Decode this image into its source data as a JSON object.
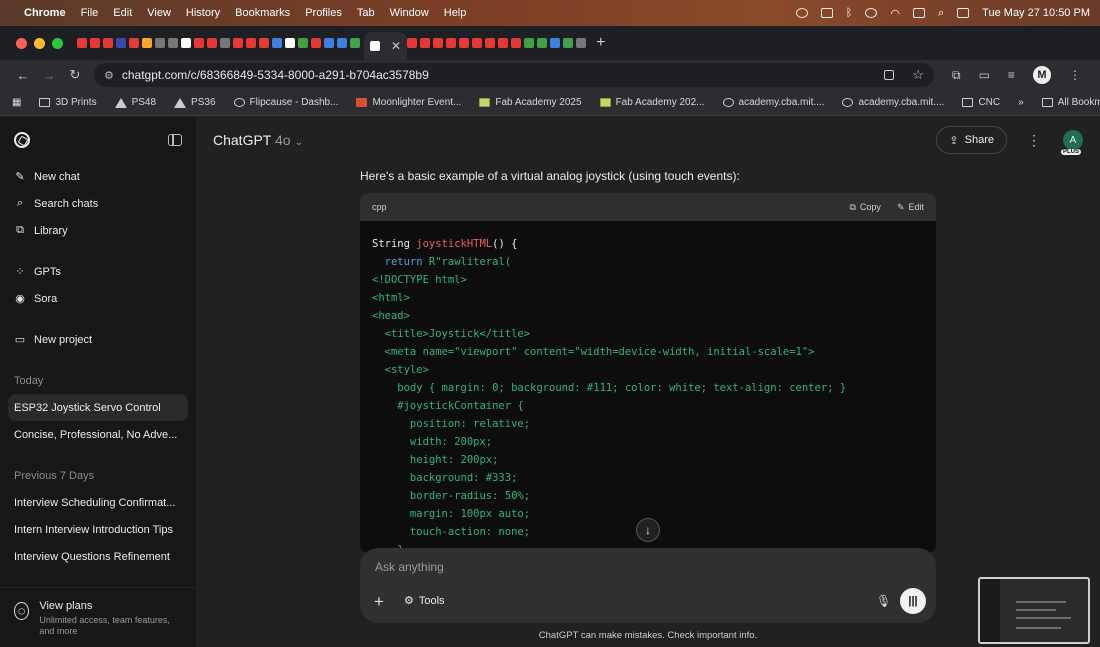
{
  "menubar": {
    "app": "Chrome",
    "items": [
      "File",
      "Edit",
      "View",
      "History",
      "Bookmarks",
      "Profiles",
      "Tab",
      "Window",
      "Help"
    ],
    "clock": "Tue May 27  10:50 PM"
  },
  "browser": {
    "url": "chatgpt.com/c/68366849-5334-8000-a291-b704ac3578b9",
    "bookmarks": [
      "3D Prints",
      "PS48",
      "PS36",
      "Flipcause - Dashb...",
      "Moonlighter Event...",
      "Fab Academy 2025",
      "Fab Academy 202...",
      "academy.cba.mit....",
      "academy.cba.mit....",
      "CNC"
    ],
    "all_bookmarks": "All Bookmarks",
    "profile_initial": "M"
  },
  "sidebar": {
    "actions": [
      {
        "label": "New chat",
        "icon": "pencil-square-icon"
      },
      {
        "label": "Search chats",
        "icon": "search-icon"
      },
      {
        "label": "Library",
        "icon": "library-icon"
      }
    ],
    "tools": [
      {
        "label": "GPTs",
        "icon": "grid-icon"
      },
      {
        "label": "Sora",
        "icon": "play-circle-icon"
      }
    ],
    "new_project": "New project",
    "today_label": "Today",
    "today_chats": [
      "ESP32 Joystick Servo Control",
      "Concise, Professional, No Adve..."
    ],
    "prev_label": "Previous 7 Days",
    "prev_chats": [
      "Interview Scheduling Confirmat...",
      "Intern Interview Introduction Tips",
      "Interview Questions Refinement"
    ],
    "view_plans_title": "View plans",
    "view_plans_sub": "Unlimited access, team features, and more"
  },
  "header": {
    "model_name": "ChatGPT",
    "model_version": "4o",
    "share_label": "Share",
    "avatar_initial": "A",
    "plan_badge": "PLUS"
  },
  "message": {
    "intro": "Here's a basic example of a virtual analog joystick (using touch events):",
    "code_lang": "cpp",
    "copy_label": "Copy",
    "edit_label": "Edit",
    "code": {
      "l1a": "String ",
      "l1fn": "joystickHTML",
      "l1b": "() {",
      "l2kw": "  return ",
      "l2b": "R\"rawliteral(",
      "lines": [
        "<!DOCTYPE html>",
        "<html>",
        "<head>",
        "  <title>Joystick</title>",
        "  <meta name=\"viewport\" content=\"width=device-width, initial-scale=1\">",
        "  <style>",
        "    body { margin: 0; background: #111; color: white; text-align: center; }",
        "    #joystickContainer {",
        "      position: relative;",
        "      width: 200px;",
        "      height: 200px;",
        "      background: #333;",
        "      border-radius: 50%;",
        "      margin: 100px auto;",
        "      touch-action: none;",
        "    }"
      ]
    }
  },
  "composer": {
    "placeholder": "Ask anything",
    "tools_label": "Tools"
  },
  "disclaimer": "ChatGPT can make mistakes. Check important info."
}
